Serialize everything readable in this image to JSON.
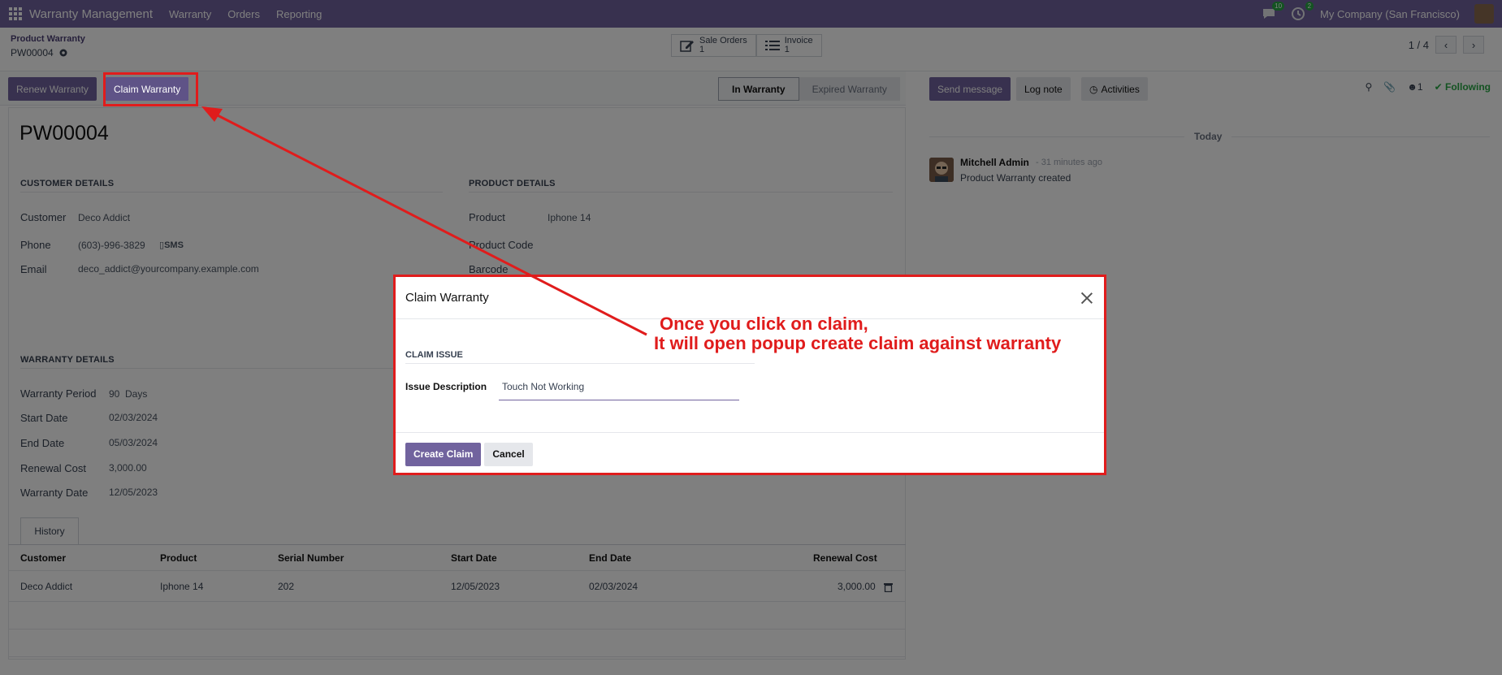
{
  "navbar": {
    "brand": "Warranty Management",
    "menu": [
      "Warranty",
      "Orders",
      "Reporting"
    ],
    "messages_count": "10",
    "activities_count": "2",
    "company": "My Company (San Francisco)"
  },
  "control": {
    "breadcrumb": "Product Warranty",
    "record": "PW00004",
    "smart_buttons": [
      {
        "label": "Sale Orders",
        "count": "1"
      },
      {
        "label": "Invoice",
        "count": "1"
      }
    ],
    "pager": "1 / 4"
  },
  "actions": {
    "renew": "Renew Warranty",
    "claim": "Claim Warranty"
  },
  "statusbar": {
    "active": "In Warranty",
    "inactive": "Expired Warranty"
  },
  "form": {
    "title": "PW00004",
    "customer_section": "CUSTOMER DETAILS",
    "customer_label": "Customer",
    "customer": "Deco Addict",
    "phone_label": "Phone",
    "phone": "(603)-996-3829",
    "sms": "SMS",
    "email_label": "Email",
    "email": "deco_addict@yourcompany.example.com",
    "product_section": "PRODUCT DETAILS",
    "product_label": "Product",
    "product": "Iphone 14",
    "product_code_label": "Product Code",
    "barcode_label": "Barcode",
    "warranty_section": "WARRANTY DETAILS",
    "period_label": "Warranty Period",
    "period": "90  Days",
    "start_label": "Start Date",
    "start": "02/03/2024",
    "end_label": "End Date",
    "end": "05/03/2024",
    "renewal_label": "Renewal Cost",
    "renewal": "3,000.00",
    "wdate_label": "Warranty Date",
    "wdate": "12/05/2023"
  },
  "history": {
    "tab": "History",
    "headers": [
      "Customer",
      "Product",
      "Serial Number",
      "Start Date",
      "End Date",
      "Renewal Cost"
    ],
    "rows": [
      [
        "Deco Addict",
        "Iphone 14",
        "202",
        "12/05/2023",
        "02/03/2024",
        "3,000.00"
      ]
    ]
  },
  "chatter": {
    "send_message": "Send message",
    "log_note": "Log note",
    "activities": "Activities",
    "followers_count": "1",
    "following": "Following",
    "today": "Today",
    "author": "Mitchell Admin",
    "time": "- 31 minutes ago",
    "body": "Product Warranty created"
  },
  "dialog": {
    "title": "Claim Warranty",
    "section": "CLAIM ISSUE",
    "issue_label": "Issue Description",
    "issue_value": "Touch Not Working",
    "create": "Create Claim",
    "cancel": "Cancel"
  },
  "annotation": {
    "line1": "Once you click on claim,",
    "line2": "It will open popup create claim against warranty",
    "color": "#e01c1c"
  },
  "colors": {
    "brand": "#71639e",
    "accent_green": "#28a745"
  }
}
